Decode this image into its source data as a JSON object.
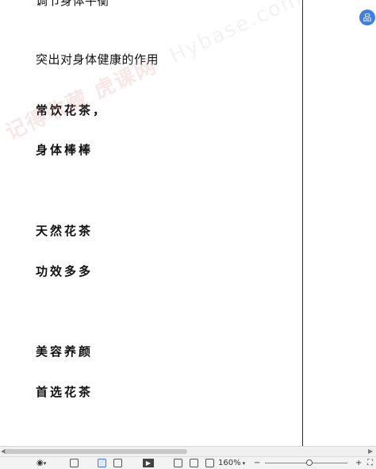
{
  "document": {
    "lines": [
      {
        "text": "调节身体平衡",
        "style": "normal"
      },
      {
        "text": "突出对身体健康的作用",
        "style": "normal"
      },
      {
        "text": "常饮花茶，",
        "style": "bold"
      },
      {
        "text": "身体棒棒",
        "style": "bold"
      },
      {
        "text": "天然花茶",
        "style": "bold"
      },
      {
        "text": "功效多多",
        "style": "bold"
      },
      {
        "text": "美容养颜",
        "style": "bold"
      },
      {
        "text": "首选花茶",
        "style": "bold"
      }
    ],
    "watermark": {
      "cn": "记得收藏 虎课网 ",
      "en": "Hybase.com"
    }
  },
  "float_button": {
    "label": "品"
  },
  "status_bar": {
    "zoom": "160%",
    "zoom_minus": "−",
    "zoom_plus": "+"
  },
  "colors": {
    "accent": "#3f7fe4",
    "page_edge": "#2b2b2b"
  }
}
